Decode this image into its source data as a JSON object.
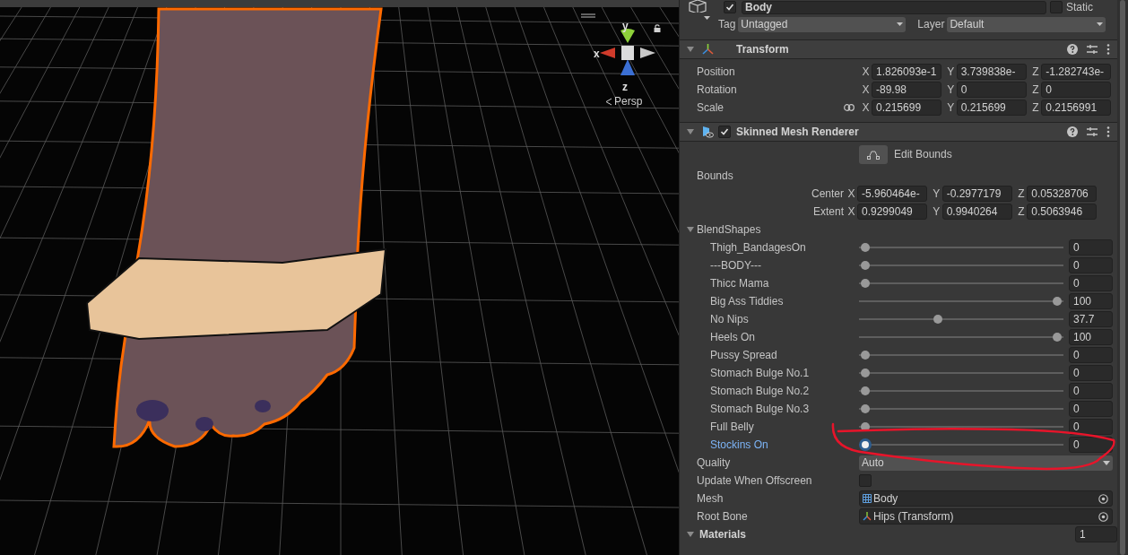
{
  "scene": {
    "gizmo": {
      "y": "y",
      "x": "x",
      "z": "z"
    },
    "projection": "Persp"
  },
  "object": {
    "active": true,
    "name": "Body",
    "static": false,
    "static_label": "Static",
    "tag_label": "Tag",
    "tag": "Untagged",
    "layer_label": "Layer",
    "layer": "Default"
  },
  "transform": {
    "title": "Transform",
    "expanded": true,
    "rows": [
      {
        "label": "Position",
        "linked": false,
        "fields": [
          {
            "axis": "X",
            "value": "1.826093e-1"
          },
          {
            "axis": "Y",
            "value": "3.739838e-"
          },
          {
            "axis": "Z",
            "value": "-1.282743e-"
          }
        ]
      },
      {
        "label": "Rotation",
        "linked": false,
        "fields": [
          {
            "axis": "X",
            "value": "-89.98"
          },
          {
            "axis": "Y",
            "value": "0"
          },
          {
            "axis": "Z",
            "value": "0"
          }
        ]
      },
      {
        "label": "Scale",
        "linked": true,
        "fields": [
          {
            "axis": "X",
            "value": "0.215699"
          },
          {
            "axis": "Y",
            "value": "0.215699"
          },
          {
            "axis": "Z",
            "value": "0.2156991"
          }
        ]
      }
    ]
  },
  "renderer": {
    "title": "Skinned Mesh Renderer",
    "enabled": true,
    "expanded": true,
    "edit_bounds": "Edit Bounds",
    "bounds_label": "Bounds",
    "bounds": [
      {
        "label": "Center",
        "fields": [
          {
            "axis": "X",
            "value": "-5.960464e-"
          },
          {
            "axis": "Y",
            "value": "-0.2977179"
          },
          {
            "axis": "Z",
            "value": "0.05328706"
          }
        ]
      },
      {
        "label": "Extent",
        "fields": [
          {
            "axis": "X",
            "value": "0.9299049"
          },
          {
            "axis": "Y",
            "value": "0.9940264"
          },
          {
            "axis": "Z",
            "value": "0.5063946"
          }
        ]
      }
    ],
    "blend_shapes": {
      "title": "BlendShapes",
      "expanded": true,
      "items": [
        {
          "name": "Thigh_BandagesOn",
          "level": 0,
          "value": "0",
          "selected": false
        },
        {
          "name": "---BODY---",
          "level": 0,
          "value": "0",
          "selected": false
        },
        {
          "name": "Thicc Mama",
          "level": 0,
          "value": "0",
          "selected": false
        },
        {
          "name": "Big Ass Tiddies",
          "level": 1,
          "value": "100",
          "selected": false
        },
        {
          "name": "No Nips",
          "level": 0.377,
          "value": "37.7",
          "selected": false
        },
        {
          "name": "Heels On",
          "level": 1,
          "value": "100",
          "selected": false
        },
        {
          "name": "Pussy Spread",
          "level": 0,
          "value": "0",
          "selected": false
        },
        {
          "name": "Stomach Bulge No.1",
          "level": 0,
          "value": "0",
          "selected": false
        },
        {
          "name": "Stomach Bulge No.2",
          "level": 0,
          "value": "0",
          "selected": false
        },
        {
          "name": "Stomach Bulge No.3",
          "level": 0,
          "value": "0",
          "selected": false
        },
        {
          "name": "Full Belly",
          "level": 0,
          "value": "0",
          "selected": false
        },
        {
          "name": "Stockins On",
          "level": 0,
          "value": "0",
          "selected": true
        }
      ]
    },
    "quality": {
      "label": "Quality",
      "value": "Auto"
    },
    "update_offscreen": {
      "label": "Update When Offscreen",
      "checked": false
    },
    "mesh": {
      "label": "Mesh",
      "value": "Body"
    },
    "root_bone": {
      "label": "Root Bone",
      "value": "Hips (Transform)"
    },
    "materials": {
      "title": "Materials",
      "expanded": true,
      "count": "1"
    }
  }
}
